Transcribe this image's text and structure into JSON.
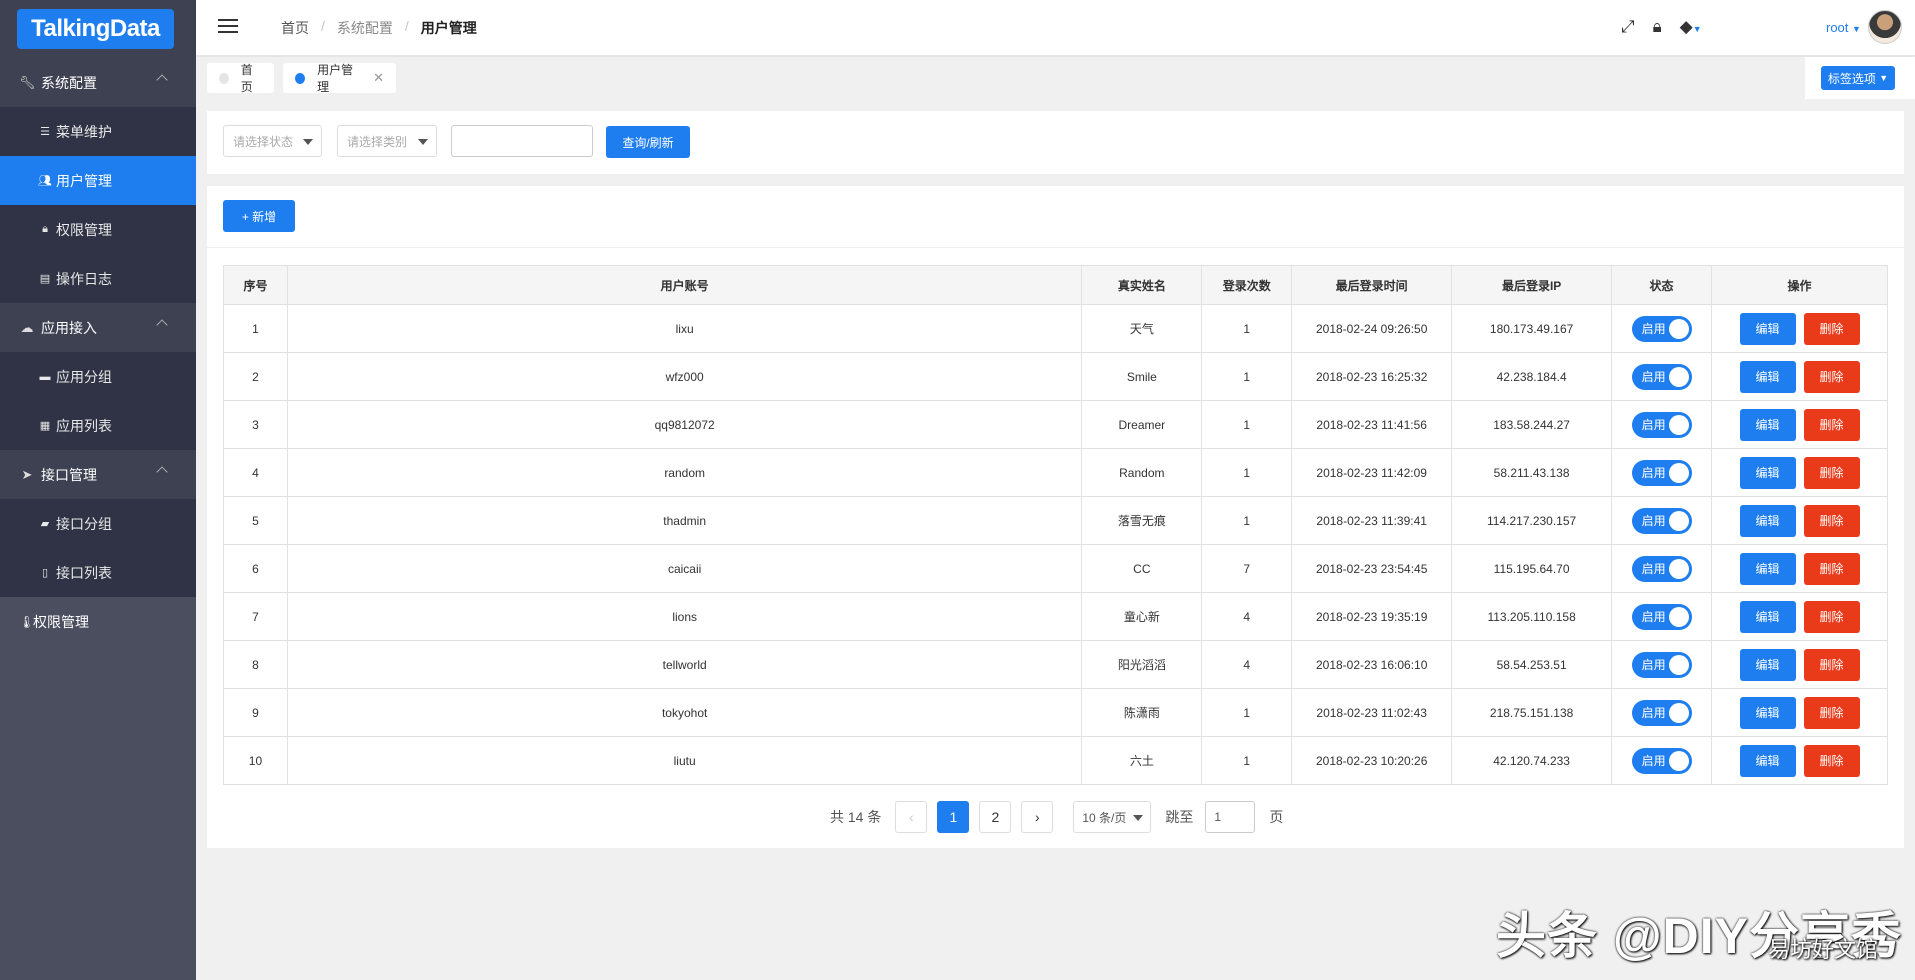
{
  "logo": {
    "text": "TalkingData"
  },
  "sidebar": {
    "groups": [
      {
        "label": "系统配置",
        "icon": "wrench-icon",
        "items": [
          {
            "label": "菜单维护",
            "icon": "list-icon"
          },
          {
            "label": "用户管理",
            "icon": "users-icon",
            "active": true
          },
          {
            "label": "权限管理",
            "icon": "lock-icon"
          },
          {
            "label": "操作日志",
            "icon": "log-icon"
          }
        ]
      },
      {
        "label": "应用接入",
        "icon": "cloud-icon",
        "items": [
          {
            "label": "应用分组",
            "icon": "folder-icon"
          },
          {
            "label": "应用列表",
            "icon": "table-icon"
          }
        ]
      },
      {
        "label": "接口管理",
        "icon": "send-icon",
        "items": [
          {
            "label": "接口分组",
            "icon": "folder-open-icon"
          },
          {
            "label": "接口列表",
            "icon": "file-icon"
          }
        ]
      }
    ],
    "flat_item": {
      "label": "权限管理",
      "icon": "thermometer-icon"
    }
  },
  "header": {
    "breadcrumb": [
      "首页",
      "系统配置",
      "用户管理"
    ],
    "user": "root"
  },
  "tabs": [
    {
      "label": "首页"
    },
    {
      "label": "用户管理"
    }
  ],
  "tab_options": "标签选项",
  "filter": {
    "status_placeholder": "请选择状态",
    "category_placeholder": "请选择类别",
    "query_label": "查询/刷新"
  },
  "add_label": "+ 新增",
  "table": {
    "headers": [
      "序号",
      "用户账号",
      "真实姓名",
      "登录次数",
      "最后登录时间",
      "最后登录IP",
      "状态",
      "操作"
    ],
    "rows": [
      [
        "1",
        "lixu",
        "天气",
        "1",
        "2018-02-24 09:26:50",
        "180.173.49.167"
      ],
      [
        "2",
        "wfz000",
        "Smile",
        "1",
        "2018-02-23 16:25:32",
        "42.238.184.4"
      ],
      [
        "3",
        "qq9812072",
        "Dreamer",
        "1",
        "2018-02-23 11:41:56",
        "183.58.244.27"
      ],
      [
        "4",
        "random",
        "Random",
        "1",
        "2018-02-23 11:42:09",
        "58.211.43.138"
      ],
      [
        "5",
        "thadmin",
        "落雪无痕",
        "1",
        "2018-02-23 11:39:41",
        "114.217.230.157"
      ],
      [
        "6",
        "caicaii",
        "CC",
        "7",
        "2018-02-23 23:54:45",
        "115.195.64.70"
      ],
      [
        "7",
        "lions",
        "童心新",
        "4",
        "2018-02-23 19:35:19",
        "113.205.110.158"
      ],
      [
        "8",
        "tellworld",
        "阳光滔滔",
        "4",
        "2018-02-23 16:06:10",
        "58.54.253.51"
      ],
      [
        "9",
        "tokyohot",
        "陈潇雨",
        "1",
        "2018-02-23 11:02:43",
        "218.75.151.138"
      ],
      [
        "10",
        "liutu",
        "六土",
        "1",
        "2018-02-23 10:20:26",
        "42.120.74.233"
      ]
    ],
    "status_label": "启用",
    "edit_label": "编辑",
    "delete_label": "删除"
  },
  "pagination": {
    "total": "共 14 条",
    "pages": [
      "1",
      "2"
    ],
    "current": "1",
    "page_size": "10 条/页",
    "jump_label": "跳至",
    "jump_value": "1",
    "page_suffix": "页"
  },
  "watermark": {
    "main": "头条 @DIY分享秀",
    "sub": "易坊好文馆"
  },
  "colors": {
    "primary": "#1e7ef0",
    "danger": "#e93a1a",
    "sidebar": "#4a4e5f"
  }
}
